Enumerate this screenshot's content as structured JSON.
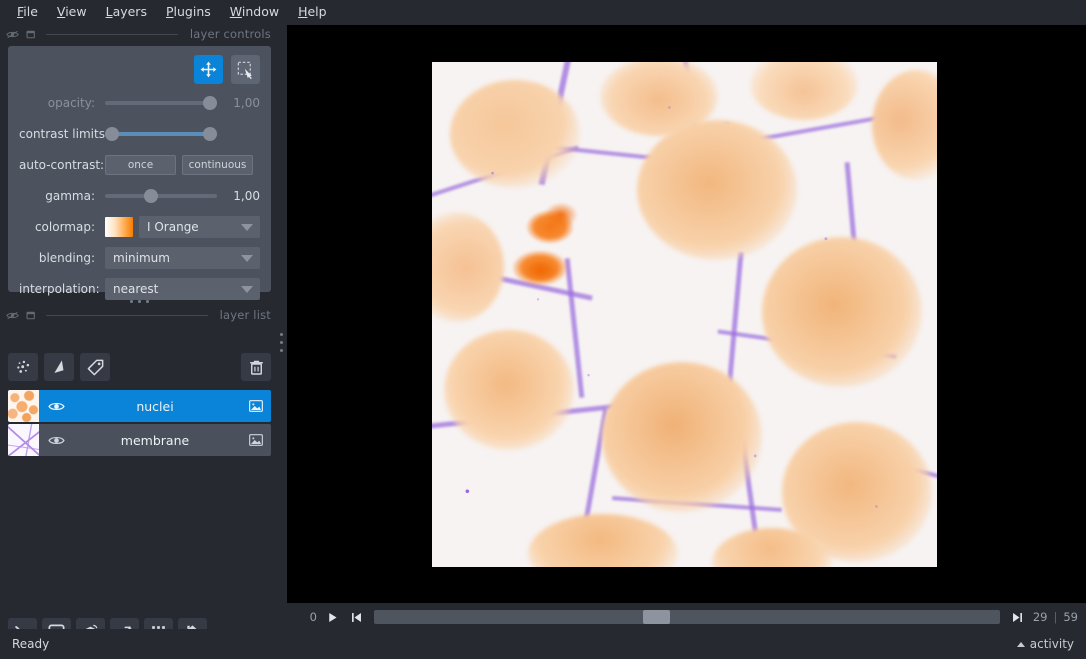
{
  "menubar": {
    "items": [
      {
        "label": "File",
        "accel": "F"
      },
      {
        "label": "View",
        "accel": "V"
      },
      {
        "label": "Layers",
        "accel": "L"
      },
      {
        "label": "Plugins",
        "accel": "P"
      },
      {
        "label": "Window",
        "accel": "W"
      },
      {
        "label": "Help",
        "accel": "H"
      }
    ]
  },
  "layer_controls": {
    "dock_title": "layer controls",
    "mode_buttons": [
      {
        "name": "pan-zoom",
        "icon": "move-icon",
        "active": true
      },
      {
        "name": "transform",
        "icon": "transform-icon",
        "active": false
      }
    ],
    "opacity": {
      "label": "opacity:",
      "value": "1,00",
      "handle_pct": 100
    },
    "contrast_limits": {
      "label": "contrast limits:",
      "low_pct": 0,
      "high_pct": 100
    },
    "auto_contrast": {
      "label": "auto-contrast:",
      "once": "once",
      "continuous": "continuous"
    },
    "gamma": {
      "label": "gamma:",
      "value": "1,00",
      "handle_pct": 35
    },
    "colormap": {
      "label": "colormap:",
      "value": "I Orange"
    },
    "blending": {
      "label": "blending:",
      "value": "minimum"
    },
    "interpolation": {
      "label": "interpolation:",
      "value": "nearest"
    }
  },
  "layer_list": {
    "dock_title": "layer list",
    "add_buttons": [
      {
        "name": "new-points-layer",
        "icon": "points-icon"
      },
      {
        "name": "new-shapes-layer",
        "icon": "shapes-icon"
      },
      {
        "name": "new-labels-layer",
        "icon": "labels-icon"
      }
    ],
    "delete_button": {
      "name": "delete-layer",
      "icon": "trash-icon"
    },
    "layers": [
      {
        "name": "nuclei",
        "selected": true,
        "visible": true,
        "type_icon": "image-icon",
        "thumb": "orange"
      },
      {
        "name": "membrane",
        "selected": false,
        "visible": true,
        "type_icon": "image-icon",
        "thumb": "purple"
      }
    ]
  },
  "viewer_buttons": [
    {
      "name": "console-button",
      "icon": "console-icon"
    },
    {
      "name": "ndisplay-2d-button",
      "icon": "square-icon"
    },
    {
      "name": "ndisplay-3d-button",
      "icon": "cube-icon"
    },
    {
      "name": "roll-dims-button",
      "icon": "roll-icon"
    },
    {
      "name": "grid-view-button",
      "icon": "grid-icon"
    },
    {
      "name": "reset-view-button",
      "icon": "home-icon"
    }
  ],
  "dims": {
    "axis_label": "0",
    "play_button": "play-icon",
    "first_frame_button": "skip-start-icon",
    "last_frame_button": "skip-end-icon",
    "current": "29",
    "separator": "|",
    "total": "59",
    "handle_pct": 45
  },
  "statusbar": {
    "status": "Ready",
    "activity": "activity"
  },
  "colors": {
    "accent": "#0a84d8",
    "panel": "#4c525e",
    "background": "#262930",
    "canvas": "#000000",
    "nuclei": "#f2a25c",
    "membrane": "#9b6ede"
  }
}
